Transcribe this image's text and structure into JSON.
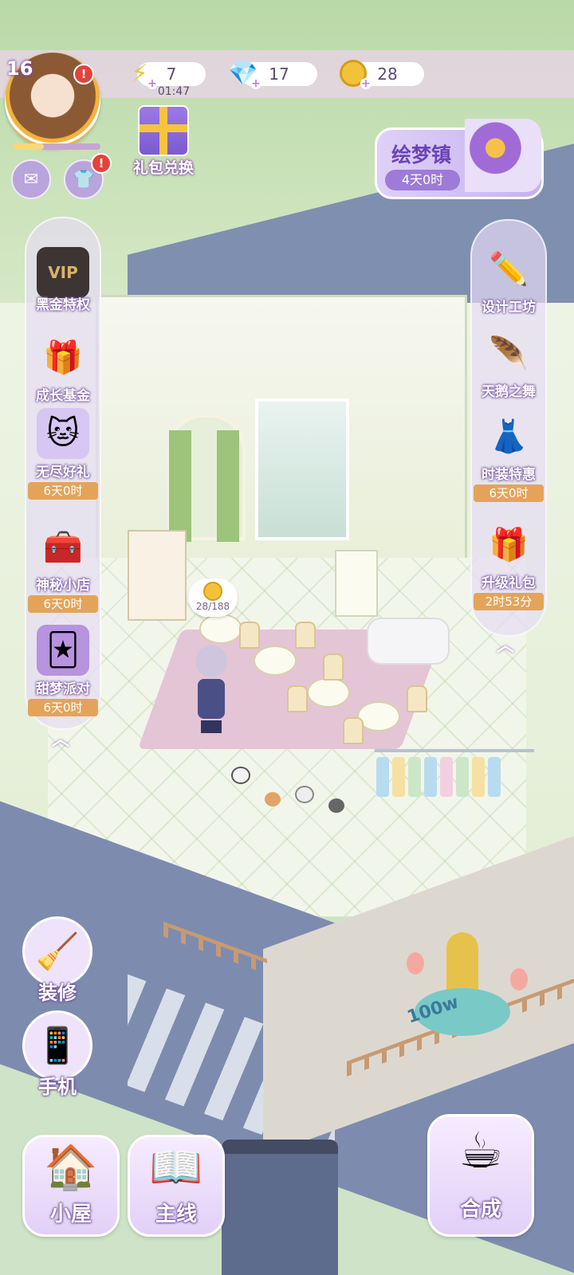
{
  "player": {
    "level": "16",
    "avatar_alert": "!",
    "wardrobe_alert": "!",
    "exp_fraction": 0.35
  },
  "resources": {
    "energy": "7",
    "energy_timer": "01:47",
    "diamonds": "17",
    "coins": "28"
  },
  "gift_exchange": {
    "label": "礼包兑换"
  },
  "event": {
    "title": "绘梦镇",
    "time": "4天0时"
  },
  "left_panel": [
    {
      "label": "黑金特权",
      "timer": ""
    },
    {
      "label": "成长基金",
      "timer": ""
    },
    {
      "label": "无尽好礼",
      "timer": "6天0时"
    },
    {
      "label": "神秘小店",
      "timer": "6天0时"
    },
    {
      "label": "甜梦派对",
      "timer": "6天0时"
    }
  ],
  "right_panel": [
    {
      "label": "设计工坊",
      "timer": ""
    },
    {
      "label": "天鹅之舞",
      "timer": ""
    },
    {
      "label": "时装特惠",
      "timer": "6天0时"
    },
    {
      "label": "升级礼包",
      "timer": "2时53分"
    }
  ],
  "vip_text": "VIP",
  "coin_bubble": "28/188",
  "fountain_sign": "100w",
  "side_buttons": {
    "decorate": "装修",
    "phone": "手机"
  },
  "bottom_nav": {
    "house": "小屋",
    "main": "主线",
    "merge": "合成"
  },
  "colors": {
    "hud_bar": "#ecd2eb",
    "accent": "#9d7bd7",
    "timer_tag": "#e3a45a",
    "alert": "#e3433b"
  }
}
